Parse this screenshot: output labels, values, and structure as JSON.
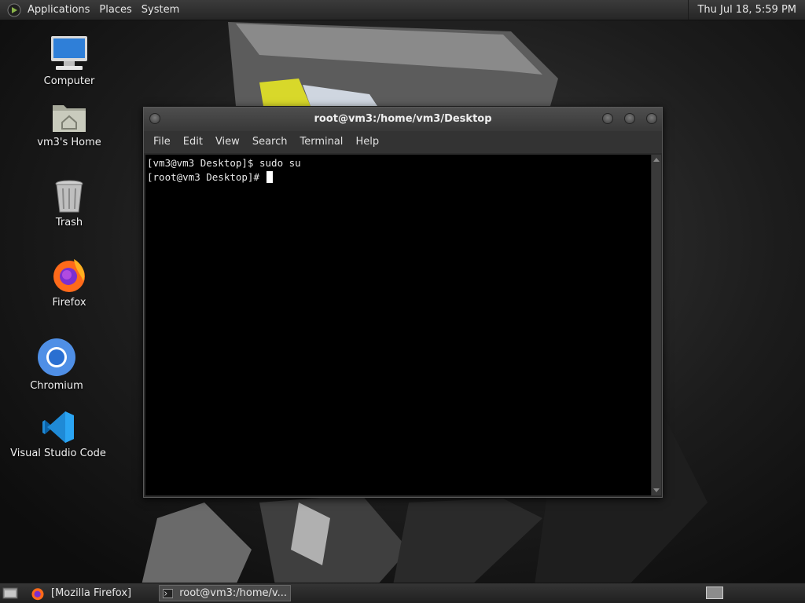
{
  "top_panel": {
    "menus": [
      "Applications",
      "Places",
      "System"
    ],
    "clock": "Thu Jul 18,  5:59 PM"
  },
  "desktop": {
    "icons": [
      {
        "label": "Computer",
        "icon": "computer-icon"
      },
      {
        "label": "vm3's Home",
        "icon": "home-folder-icon"
      },
      {
        "label": "Trash",
        "icon": "trash-icon"
      },
      {
        "label": "Firefox",
        "icon": "firefox-icon"
      },
      {
        "label": "Chromium",
        "icon": "chromium-icon"
      },
      {
        "label": "Visual Studio Code",
        "icon": "vscode-icon"
      }
    ]
  },
  "terminal": {
    "title": "root@vm3:/home/vm3/Desktop",
    "menu": [
      "File",
      "Edit",
      "View",
      "Search",
      "Terminal",
      "Help"
    ],
    "lines": [
      "[vm3@vm3 Desktop]$ sudo su",
      "[root@vm3 Desktop]# "
    ]
  },
  "bottom_panel": {
    "tasks": [
      {
        "label": "[Mozilla Firefox]",
        "icon": "firefox-icon",
        "active": false
      },
      {
        "label": "root@vm3:/home/v...",
        "icon": "terminal-icon",
        "active": true
      }
    ]
  },
  "colors": {
    "panel": "#2e2e2e",
    "terminal_bg": "#000000",
    "terminal_fg": "#e8e8e8"
  }
}
